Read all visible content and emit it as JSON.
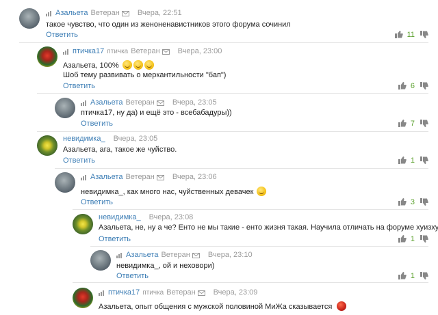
{
  "labels": {
    "reply": "Ответить"
  },
  "comments": [
    {
      "author": "Азальета",
      "rank": "Ветеран",
      "time": "Вчера, 22:51",
      "text": "такое чувство, что один из женоненавистников этого форума сочинил",
      "votes": "11",
      "avatar_icon": "avatar-icon"
    },
    {
      "author": "птичка17",
      "rank": "птичка",
      "rank2": "Ветеран",
      "time": "Вчера, 23:00",
      "text": "Азальета, 100%",
      "text2": "Шоб тему развивать о меркантильности \"бап\")",
      "votes": "6",
      "avatar_icon": "avatar-icon"
    },
    {
      "author": "Азальета",
      "rank": "Ветеран",
      "time": "Вчера, 23:05",
      "text": "птичка17, ну да) и ещё это - всебабадуры))",
      "votes": "7",
      "avatar_icon": "avatar-icon"
    },
    {
      "author": "невидимка_",
      "time": "Вчера, 23:05",
      "text": "Азальета, ага, такое же чуйство.",
      "votes": "1",
      "avatar_icon": "avatar-icon"
    },
    {
      "author": "Азальета",
      "rank": "Ветеран",
      "time": "Вчера, 23:06",
      "text": "невидимка_, как много нас, чуйственных девачек",
      "votes": "3",
      "avatar_icon": "avatar-icon"
    },
    {
      "author": "невидимка_",
      "time": "Вчера, 23:08",
      "text": "Азальета, не, ну а че? Енто не мы такие - енто жизня такая. Научила отличать на форуме хуизху))",
      "votes": "1",
      "avatar_icon": "avatar-icon"
    },
    {
      "author": "Азальета",
      "rank": "Ветеран",
      "time": "Вчера, 23:10",
      "text": "невидимка_, ой и неховори)",
      "votes": "1",
      "avatar_icon": "avatar-icon"
    },
    {
      "author": "птичка17",
      "rank": "птичка",
      "rank2": "Ветеран",
      "time": "Вчера, 23:09",
      "text": "Азальета, опыт общения с мужской половиной МиЖа сказывается",
      "avatar_icon": "avatar-icon"
    }
  ],
  "colors": {
    "link": "#3f7fb6",
    "muted": "#9a9a9a",
    "vote_count": "#5aa02c",
    "divider": "#e4e4e4"
  }
}
